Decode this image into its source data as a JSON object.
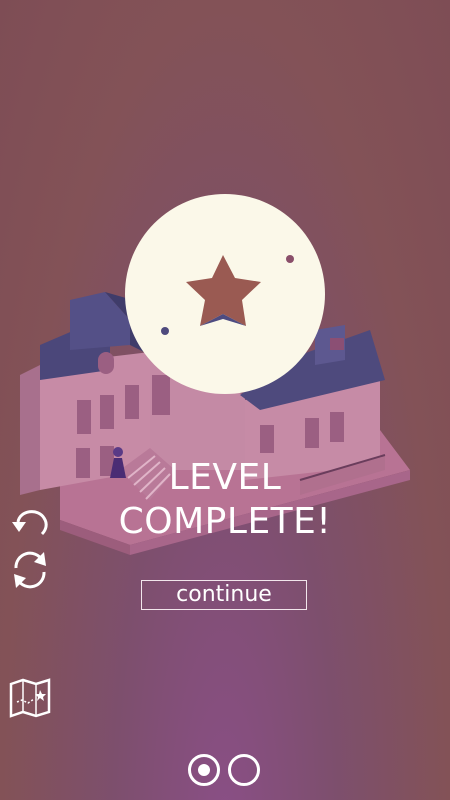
{
  "level_complete": {
    "title_line1": "LEVEL",
    "title_line2": "COMPLETE!"
  },
  "continue_button": {
    "label": "continue"
  },
  "controls": {
    "undo_icon": "undo-icon",
    "restart_icon": "restart-icon",
    "map_icon": "map-icon"
  },
  "pagination": {
    "pages": 2,
    "active": 1
  },
  "colors": {
    "background": "#80505a",
    "medal": "#fbf8e9",
    "star_cutout": "#9c5a52",
    "building_wall": "#c98aa6",
    "roof": "#4f4a7a"
  }
}
